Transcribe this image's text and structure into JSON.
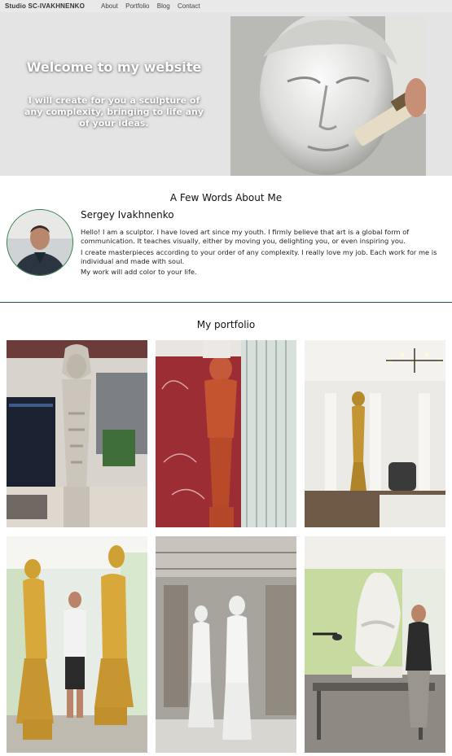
{
  "nav": {
    "brand": "Studio SC-IVAKHNENKO",
    "links": [
      "About",
      "Portfolio",
      "Blog",
      "Contact"
    ]
  },
  "hero": {
    "title": "Welcome to my website",
    "subtitle": "I will create for you a sculpture of any complexity, bringing to life any of your ideas."
  },
  "about": {
    "title": "A Few Words About Me",
    "name": "Sergey Ivakhnenko",
    "paragraphs": [
      "Hello! I am a sculptor. I have loved art since my youth. I firmly believe that art is a global form of communication. It teaches visually, either by moving you, delighting you, or even inspiring you.",
      "I create masterpieces according to your order of any complexity. I really love my job. Each work for me is individual and made with soul.",
      "My work will add color to your life."
    ]
  },
  "portfolio": {
    "title": "My portfolio"
  }
}
